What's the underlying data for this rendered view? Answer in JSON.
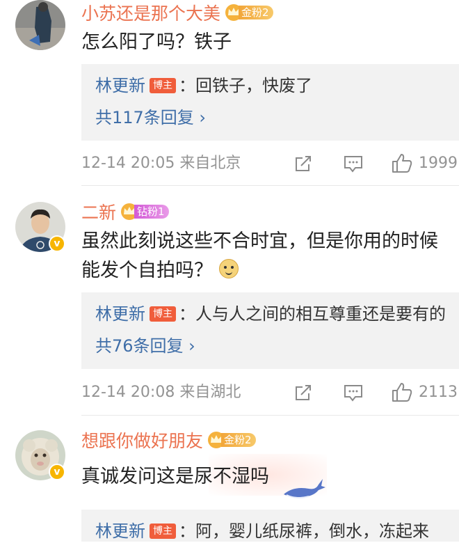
{
  "comments": [
    {
      "username": "小苏还是那个大美",
      "fan_badge": "金粉2",
      "text": "怎么阳了吗？铁子",
      "reply": {
        "author": "林更新",
        "tag": "博主",
        "text": "：回铁子，快废了",
        "more": "共117条回复 ›"
      },
      "time": "12-14 20:05",
      "location": "来自北京",
      "likes": "1999"
    },
    {
      "username": "二新",
      "fan_badge": "钻粉1",
      "text_line1": "虽然此刻说这些不合时宜，但是你用的时候",
      "text_line2": "能发个自拍吗？",
      "reply": {
        "author": "林更新",
        "tag": "博主",
        "text": "：人与人之间的相互尊重还是要有的",
        "more": "共76条回复 ›"
      },
      "time": "12-14 20:08",
      "location": "来自湖北",
      "likes": "2113"
    },
    {
      "username": "想跟你做好朋友",
      "fan_badge": "金粉2",
      "text": "真诚发问这是尿不湿吗",
      "reply": {
        "author": "林更新",
        "tag": "博主",
        "text": "：阿，婴儿纸尿裤，倒水，冻起来"
      }
    }
  ],
  "verified_mark": "v",
  "colors": {
    "username": "#eb7350",
    "link": "#3f6ea8",
    "meta": "#939393",
    "reply_bg": "#f2f2f2",
    "badge": "#f05d3b"
  },
  "icons": [
    "share-icon",
    "comment-icon",
    "like-icon",
    "crown-icon",
    "verified-icon",
    "whale-icon"
  ]
}
